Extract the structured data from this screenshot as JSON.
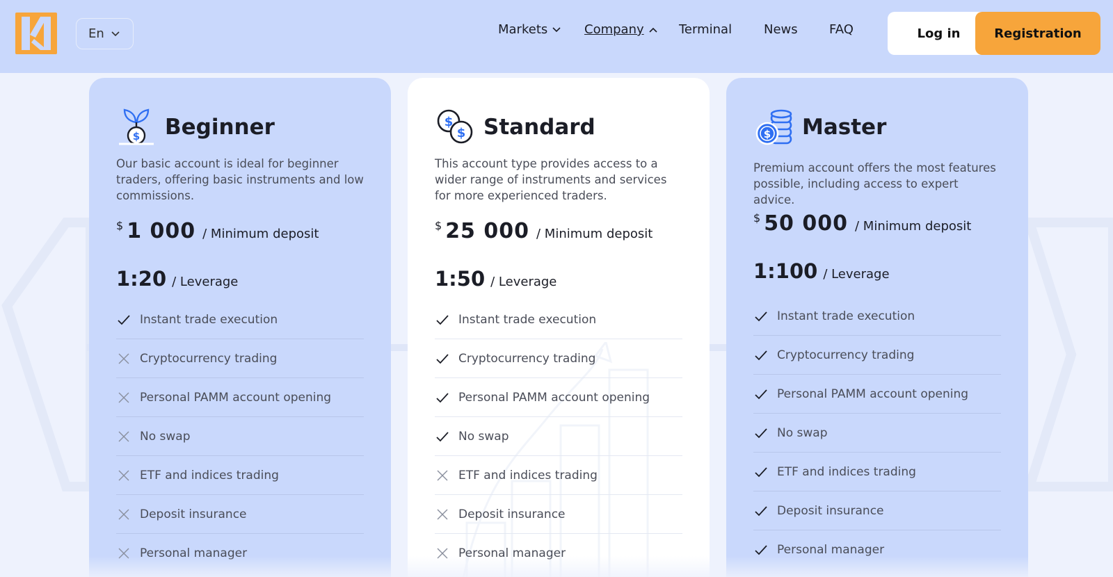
{
  "header": {
    "language": "En",
    "nav": [
      {
        "label": "Markets",
        "has_dropdown": true,
        "state": "collapsed"
      },
      {
        "label": "Company",
        "has_dropdown": true,
        "state": "expanded",
        "active": true
      },
      {
        "label": "Terminal"
      },
      {
        "label": "News"
      },
      {
        "label": "FAQ"
      }
    ],
    "login_label": "Log in",
    "register_label": "Registration"
  },
  "colors": {
    "accent": "#f7a53b",
    "header_bg": "#c9d8fc",
    "card_blue": "#c9d8fc",
    "card_white": "#ffffff",
    "icon_blue": "#2f6ff2"
  },
  "plans": [
    {
      "title": "Beginner",
      "icon": "plant-coin-icon",
      "description": "Our basic account is ideal for beginner traders, offering basic instruments and low commissions.",
      "currency": "$",
      "deposit": "1 000",
      "deposit_label": "/ Minimum deposit",
      "leverage": "1:20",
      "leverage_label": "/ Leverage",
      "features": [
        {
          "label": "Instant trade execution",
          "included": true
        },
        {
          "label": "Cryptocurrency trading",
          "included": false
        },
        {
          "label": "Personal PAMM account opening",
          "included": false
        },
        {
          "label": "No swap",
          "included": false
        },
        {
          "label": "ETF and indices trading",
          "included": false
        },
        {
          "label": "Deposit insurance",
          "included": false
        },
        {
          "label": "Personal manager",
          "included": false
        }
      ]
    },
    {
      "title": "Standard",
      "icon": "two-coins-icon",
      "description": "This account type provides access to a wider range of instruments and services for more experienced traders.",
      "currency": "$",
      "deposit": "25 000",
      "deposit_label": "/ Minimum deposit",
      "leverage": "1:50",
      "leverage_label": "/ Leverage",
      "features": [
        {
          "label": "Instant trade execution",
          "included": true
        },
        {
          "label": "Cryptocurrency trading",
          "included": true
        },
        {
          "label": "Personal PAMM account opening",
          "included": true
        },
        {
          "label": "No swap",
          "included": true
        },
        {
          "label": "ETF and indices trading",
          "included": false
        },
        {
          "label": "Deposit insurance",
          "included": false
        },
        {
          "label": "Personal manager",
          "included": false
        }
      ]
    },
    {
      "title": "Master",
      "icon": "coin-stack-icon",
      "description": "Premium account offers the most features possible, including access to expert advice.",
      "currency": "$",
      "deposit": "50 000",
      "deposit_label": "/ Minimum deposit",
      "leverage": "1:100",
      "leverage_label": "/ Leverage",
      "features": [
        {
          "label": "Instant trade execution",
          "included": true
        },
        {
          "label": "Cryptocurrency trading",
          "included": true
        },
        {
          "label": "Personal PAMM account opening",
          "included": true
        },
        {
          "label": "No swap",
          "included": true
        },
        {
          "label": "ETF and indices trading",
          "included": true
        },
        {
          "label": "Deposit insurance",
          "included": true
        },
        {
          "label": "Personal manager",
          "included": true
        }
      ]
    }
  ]
}
